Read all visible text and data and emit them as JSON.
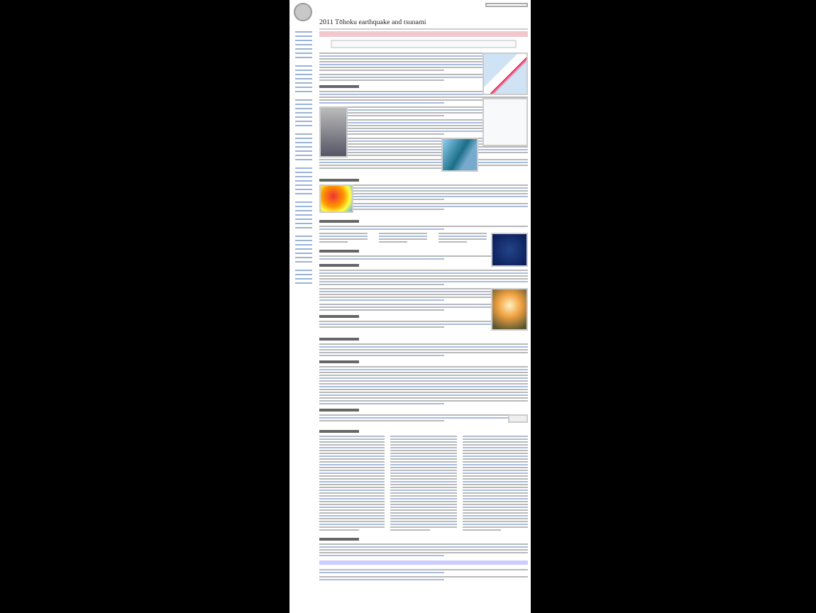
{
  "page": {
    "title": "2011 Tōhoku earthquake and tsunami"
  }
}
